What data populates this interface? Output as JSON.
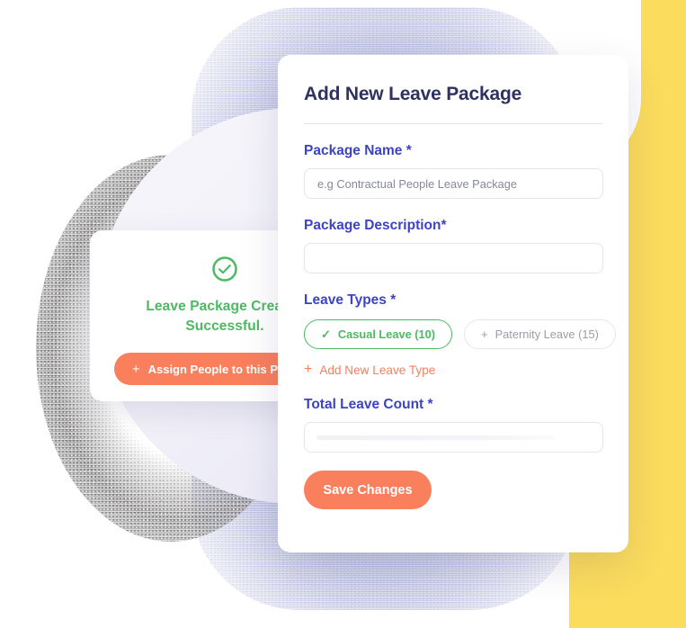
{
  "background": {
    "accent_yellow": "#FCDC5C",
    "lavender": "#AFB4DC",
    "grey_blob": "#9C9C9C",
    "pale_circle": "#F2F1F9"
  },
  "success_card": {
    "icon": "check-circle-icon",
    "message": "Leave Package Created Successful.",
    "message_visible": "Leave Package Crea",
    "message_line2": "Successful.",
    "assign_button": {
      "icon": "plus-icon",
      "label": "Assign People to this Package",
      "color": "#F97F5D"
    },
    "success_color": "#4CB963"
  },
  "form": {
    "title": "Add New Leave Package",
    "title_color": "#2F3260",
    "label_color": "#3C43C4",
    "fields": {
      "package_name": {
        "label": "Package Name *",
        "placeholder": "e.g Contractual People Leave Package",
        "value": ""
      },
      "package_description": {
        "label": "Package Description*",
        "placeholder": "",
        "value": ""
      },
      "leave_types": {
        "label": "Leave Types *",
        "chips": [
          {
            "label": "Casual Leave (10)",
            "icon": "check-icon",
            "selected": true,
            "color": "#4CB963"
          },
          {
            "label": "Paternity Leave (15)",
            "icon": "plus-icon",
            "selected": false,
            "color": "#9B9DAC"
          }
        ],
        "add_link": {
          "icon": "plus-icon",
          "label": "Add New Leave Type",
          "color": "#F97F5D"
        }
      },
      "total_leave_count": {
        "label": "Total Leave Count *",
        "placeholder": "",
        "value": ""
      }
    },
    "save_button": {
      "label": "Save Changes",
      "color": "#F97F5D"
    }
  }
}
